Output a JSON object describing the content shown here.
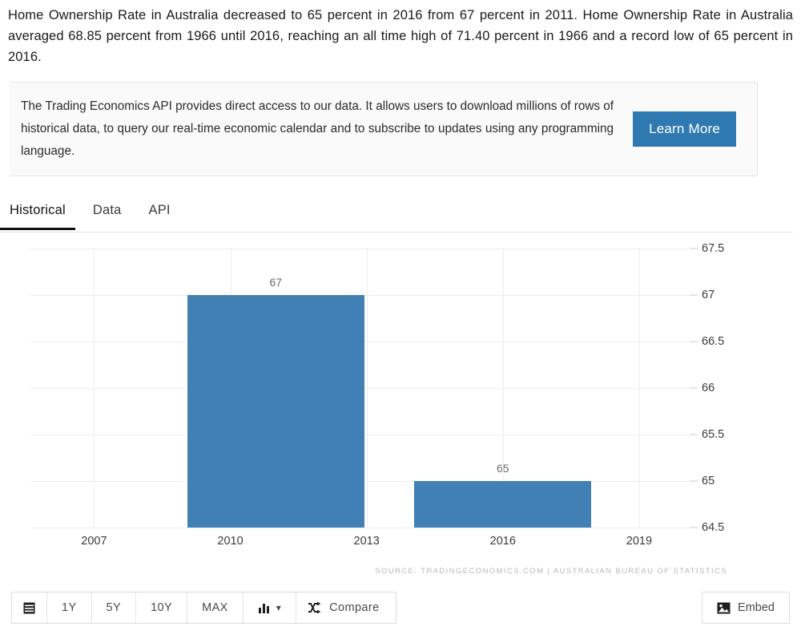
{
  "intro": {
    "text": "Home Ownership Rate in Australia decreased to 65 percent in 2016 from 67 percent in 2011. Home Ownership Rate in Australia averaged 68.85 percent from 1966 until 2016, reaching an all time high of 71.40 percent in 1966 and a record low of 65 percent in 2016."
  },
  "api_promo": {
    "text": "The Trading Economics API provides direct access to our data. It allows users to download millions of rows of historical data, to query our real-time economic calendar and to subscribe to updates using any programming language.",
    "button_label": "Learn More",
    "button_color": "#2e7ab0"
  },
  "tabs": [
    {
      "label": "Historical",
      "active": true
    },
    {
      "label": "Data",
      "active": false
    },
    {
      "label": "API",
      "active": false
    }
  ],
  "chart_source": "SOURCE: TRADINGECONOMICS.COM  |  AUSTRALIAN BUREAU OF STATISTICS",
  "toolbar": {
    "calendar_icon": "calendar-icon",
    "ranges": [
      "1Y",
      "5Y",
      "10Y",
      "MAX"
    ],
    "chart_type_icon": "bar-chart-icon",
    "chart_type_caret": "▾",
    "compare_icon": "shuffle-icon",
    "compare_label": "Compare",
    "embed_icon": "image-icon",
    "embed_label": "Embed"
  },
  "chart_data": {
    "type": "bar",
    "title": "",
    "xlabel": "",
    "ylabel": "",
    "categories": [
      "2011",
      "2016"
    ],
    "values": [
      67,
      65
    ],
    "bar_labels": [
      "67",
      "65"
    ],
    "bar_color": "#4180b4",
    "ylim": [
      64.5,
      67.5
    ],
    "yticks": [
      "67.5",
      "67",
      "66.5",
      "66",
      "65.5",
      "65",
      "64.5"
    ],
    "ytick_values": [
      67.5,
      67,
      66.5,
      66,
      65.5,
      65,
      64.5
    ],
    "xticks": [
      "2007",
      "2010",
      "2013",
      "2016",
      "2019"
    ],
    "xtick_values": [
      2007,
      2010,
      2013,
      2016,
      2019
    ],
    "xlim": [
      2005.6,
      2020.2
    ],
    "bar_width_years": 3.9,
    "grid": true,
    "legend": false,
    "legend_position": "none"
  }
}
